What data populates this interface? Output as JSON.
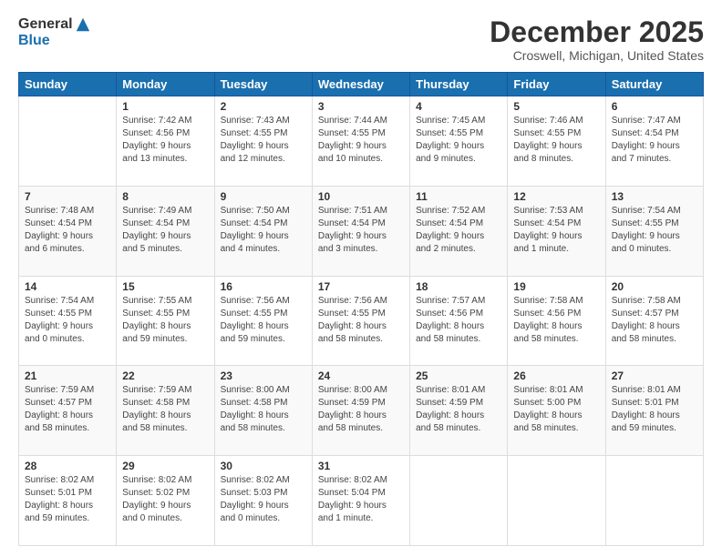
{
  "logo": {
    "general": "General",
    "blue": "Blue"
  },
  "title": "December 2025",
  "location": "Croswell, Michigan, United States",
  "days_of_week": [
    "Sunday",
    "Monday",
    "Tuesday",
    "Wednesday",
    "Thursday",
    "Friday",
    "Saturday"
  ],
  "weeks": [
    [
      {
        "day": "",
        "sunrise": "",
        "sunset": "",
        "daylight": ""
      },
      {
        "day": "1",
        "sunrise": "Sunrise: 7:42 AM",
        "sunset": "Sunset: 4:56 PM",
        "daylight": "Daylight: 9 hours and 13 minutes."
      },
      {
        "day": "2",
        "sunrise": "Sunrise: 7:43 AM",
        "sunset": "Sunset: 4:55 PM",
        "daylight": "Daylight: 9 hours and 12 minutes."
      },
      {
        "day": "3",
        "sunrise": "Sunrise: 7:44 AM",
        "sunset": "Sunset: 4:55 PM",
        "daylight": "Daylight: 9 hours and 10 minutes."
      },
      {
        "day": "4",
        "sunrise": "Sunrise: 7:45 AM",
        "sunset": "Sunset: 4:55 PM",
        "daylight": "Daylight: 9 hours and 9 minutes."
      },
      {
        "day": "5",
        "sunrise": "Sunrise: 7:46 AM",
        "sunset": "Sunset: 4:55 PM",
        "daylight": "Daylight: 9 hours and 8 minutes."
      },
      {
        "day": "6",
        "sunrise": "Sunrise: 7:47 AM",
        "sunset": "Sunset: 4:54 PM",
        "daylight": "Daylight: 9 hours and 7 minutes."
      }
    ],
    [
      {
        "day": "7",
        "sunrise": "Sunrise: 7:48 AM",
        "sunset": "Sunset: 4:54 PM",
        "daylight": "Daylight: 9 hours and 6 minutes."
      },
      {
        "day": "8",
        "sunrise": "Sunrise: 7:49 AM",
        "sunset": "Sunset: 4:54 PM",
        "daylight": "Daylight: 9 hours and 5 minutes."
      },
      {
        "day": "9",
        "sunrise": "Sunrise: 7:50 AM",
        "sunset": "Sunset: 4:54 PM",
        "daylight": "Daylight: 9 hours and 4 minutes."
      },
      {
        "day": "10",
        "sunrise": "Sunrise: 7:51 AM",
        "sunset": "Sunset: 4:54 PM",
        "daylight": "Daylight: 9 hours and 3 minutes."
      },
      {
        "day": "11",
        "sunrise": "Sunrise: 7:52 AM",
        "sunset": "Sunset: 4:54 PM",
        "daylight": "Daylight: 9 hours and 2 minutes."
      },
      {
        "day": "12",
        "sunrise": "Sunrise: 7:53 AM",
        "sunset": "Sunset: 4:54 PM",
        "daylight": "Daylight: 9 hours and 1 minute."
      },
      {
        "day": "13",
        "sunrise": "Sunrise: 7:54 AM",
        "sunset": "Sunset: 4:55 PM",
        "daylight": "Daylight: 9 hours and 0 minutes."
      }
    ],
    [
      {
        "day": "14",
        "sunrise": "Sunrise: 7:54 AM",
        "sunset": "Sunset: 4:55 PM",
        "daylight": "Daylight: 9 hours and 0 minutes."
      },
      {
        "day": "15",
        "sunrise": "Sunrise: 7:55 AM",
        "sunset": "Sunset: 4:55 PM",
        "daylight": "Daylight: 8 hours and 59 minutes."
      },
      {
        "day": "16",
        "sunrise": "Sunrise: 7:56 AM",
        "sunset": "Sunset: 4:55 PM",
        "daylight": "Daylight: 8 hours and 59 minutes."
      },
      {
        "day": "17",
        "sunrise": "Sunrise: 7:56 AM",
        "sunset": "Sunset: 4:55 PM",
        "daylight": "Daylight: 8 hours and 58 minutes."
      },
      {
        "day": "18",
        "sunrise": "Sunrise: 7:57 AM",
        "sunset": "Sunset: 4:56 PM",
        "daylight": "Daylight: 8 hours and 58 minutes."
      },
      {
        "day": "19",
        "sunrise": "Sunrise: 7:58 AM",
        "sunset": "Sunset: 4:56 PM",
        "daylight": "Daylight: 8 hours and 58 minutes."
      },
      {
        "day": "20",
        "sunrise": "Sunrise: 7:58 AM",
        "sunset": "Sunset: 4:57 PM",
        "daylight": "Daylight: 8 hours and 58 minutes."
      }
    ],
    [
      {
        "day": "21",
        "sunrise": "Sunrise: 7:59 AM",
        "sunset": "Sunset: 4:57 PM",
        "daylight": "Daylight: 8 hours and 58 minutes."
      },
      {
        "day": "22",
        "sunrise": "Sunrise: 7:59 AM",
        "sunset": "Sunset: 4:58 PM",
        "daylight": "Daylight: 8 hours and 58 minutes."
      },
      {
        "day": "23",
        "sunrise": "Sunrise: 8:00 AM",
        "sunset": "Sunset: 4:58 PM",
        "daylight": "Daylight: 8 hours and 58 minutes."
      },
      {
        "day": "24",
        "sunrise": "Sunrise: 8:00 AM",
        "sunset": "Sunset: 4:59 PM",
        "daylight": "Daylight: 8 hours and 58 minutes."
      },
      {
        "day": "25",
        "sunrise": "Sunrise: 8:01 AM",
        "sunset": "Sunset: 4:59 PM",
        "daylight": "Daylight: 8 hours and 58 minutes."
      },
      {
        "day": "26",
        "sunrise": "Sunrise: 8:01 AM",
        "sunset": "Sunset: 5:00 PM",
        "daylight": "Daylight: 8 hours and 58 minutes."
      },
      {
        "day": "27",
        "sunrise": "Sunrise: 8:01 AM",
        "sunset": "Sunset: 5:01 PM",
        "daylight": "Daylight: 8 hours and 59 minutes."
      }
    ],
    [
      {
        "day": "28",
        "sunrise": "Sunrise: 8:02 AM",
        "sunset": "Sunset: 5:01 PM",
        "daylight": "Daylight: 8 hours and 59 minutes."
      },
      {
        "day": "29",
        "sunrise": "Sunrise: 8:02 AM",
        "sunset": "Sunset: 5:02 PM",
        "daylight": "Daylight: 9 hours and 0 minutes."
      },
      {
        "day": "30",
        "sunrise": "Sunrise: 8:02 AM",
        "sunset": "Sunset: 5:03 PM",
        "daylight": "Daylight: 9 hours and 0 minutes."
      },
      {
        "day": "31",
        "sunrise": "Sunrise: 8:02 AM",
        "sunset": "Sunset: 5:04 PM",
        "daylight": "Daylight: 9 hours and 1 minute."
      },
      {
        "day": "",
        "sunrise": "",
        "sunset": "",
        "daylight": ""
      },
      {
        "day": "",
        "sunrise": "",
        "sunset": "",
        "daylight": ""
      },
      {
        "day": "",
        "sunrise": "",
        "sunset": "",
        "daylight": ""
      }
    ]
  ]
}
